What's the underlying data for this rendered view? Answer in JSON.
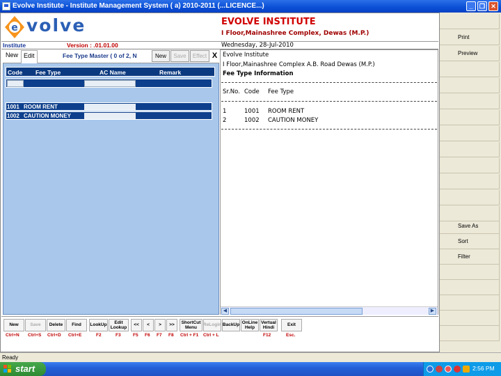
{
  "window": {
    "title": "Evolve Institute - Institute Management System ( a) 2010-2011 (...LICENCE...)"
  },
  "header": {
    "logo_text": "volve",
    "institute_name": "EVOLVE INSTITUTE",
    "institute_address": "I Floor,Mainashree Complex, Dewas (M.P.)"
  },
  "infobar": {
    "module": "Institute",
    "version": "Version : .01.01.00",
    "date": "Wednesday, 28-Jul-2010"
  },
  "form": {
    "tab_new": "New",
    "tab_edit": "Edit",
    "title": "Fee Type Master  ( 0 of 2, N",
    "btn_new": "New",
    "btn_save": "Save",
    "btn_effect": "Effect",
    "btn_close": "X"
  },
  "grid": {
    "columns": [
      "Code",
      "Fee Type",
      "AC Name",
      "Remark"
    ],
    "rows": [
      {
        "code": "1001",
        "fee_type": "ROOM RENT"
      },
      {
        "code": "1002",
        "fee_type": "CAUTION MONEY"
      }
    ]
  },
  "report": {
    "line1": "Evolve Institute",
    "line2": "I Floor,Mainashree Complex A.B. Road Dewas (M.P.)",
    "heading": "Fee Type Information",
    "columns": [
      "Sr.No.",
      "Code",
      "Fee Type"
    ],
    "rows": [
      {
        "sr": "1",
        "code": "1001",
        "fee_type": "ROOM RENT"
      },
      {
        "sr": "2",
        "code": "1002",
        "fee_type": "CAUTION MONEY"
      }
    ]
  },
  "toolbar": {
    "buttons": [
      {
        "label": "New",
        "key": "Ctrl+N"
      },
      {
        "label": "Save",
        "key": "Ctrl+S"
      },
      {
        "label": "Delete",
        "key": "Ctrl+D"
      },
      {
        "label": "Find",
        "key": "Ctrl+E"
      },
      {
        "label": "LookUp",
        "key": "F2"
      },
      {
        "label": "Edit Lookup",
        "key": "F3"
      },
      {
        "label": "<<",
        "key": "F5"
      },
      {
        "label": "<",
        "key": "F6"
      },
      {
        "label": ">",
        "key": "F7"
      },
      {
        "label": ">>",
        "key": "F8"
      },
      {
        "label": "ShortCut Menu",
        "key": "Ctrl + F1"
      },
      {
        "label": "ReLogin",
        "key": "Ctrl + L"
      },
      {
        "label": "BackUp",
        "key": ""
      },
      {
        "label": "OnLine Help",
        "key": ""
      },
      {
        "label": "Vertual Hindi",
        "key": "F12"
      },
      {
        "label": "Exit",
        "key": "Esc."
      }
    ]
  },
  "side": {
    "print": "Print",
    "preview": "Preview",
    "save_as": "Save As",
    "sort": "Sort",
    "filter": "Filter"
  },
  "status": {
    "text": "Ready"
  },
  "taskbar": {
    "start": "start",
    "clock": "2:56 PM"
  }
}
